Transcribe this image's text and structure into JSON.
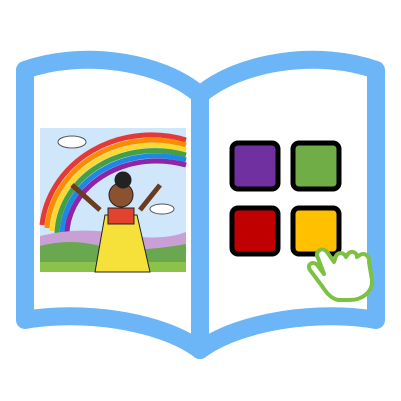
{
  "icon": "interactive-book-icon",
  "colors": {
    "book_outline": "#6cb6f7",
    "sky": "#cfe6fb",
    "grass": "#6aa84f",
    "tile_purple": "#7030a0",
    "tile_green": "#70ad47",
    "tile_red": "#c00000",
    "tile_yellow": "#ffc000",
    "hand_outline": "#7cc142"
  },
  "tiles": [
    {
      "name": "purple",
      "color": "#7030a0"
    },
    {
      "name": "green",
      "color": "#70ad47"
    },
    {
      "name": "red",
      "color": "#c00000"
    },
    {
      "name": "yellow",
      "color": "#ffc000"
    }
  ]
}
